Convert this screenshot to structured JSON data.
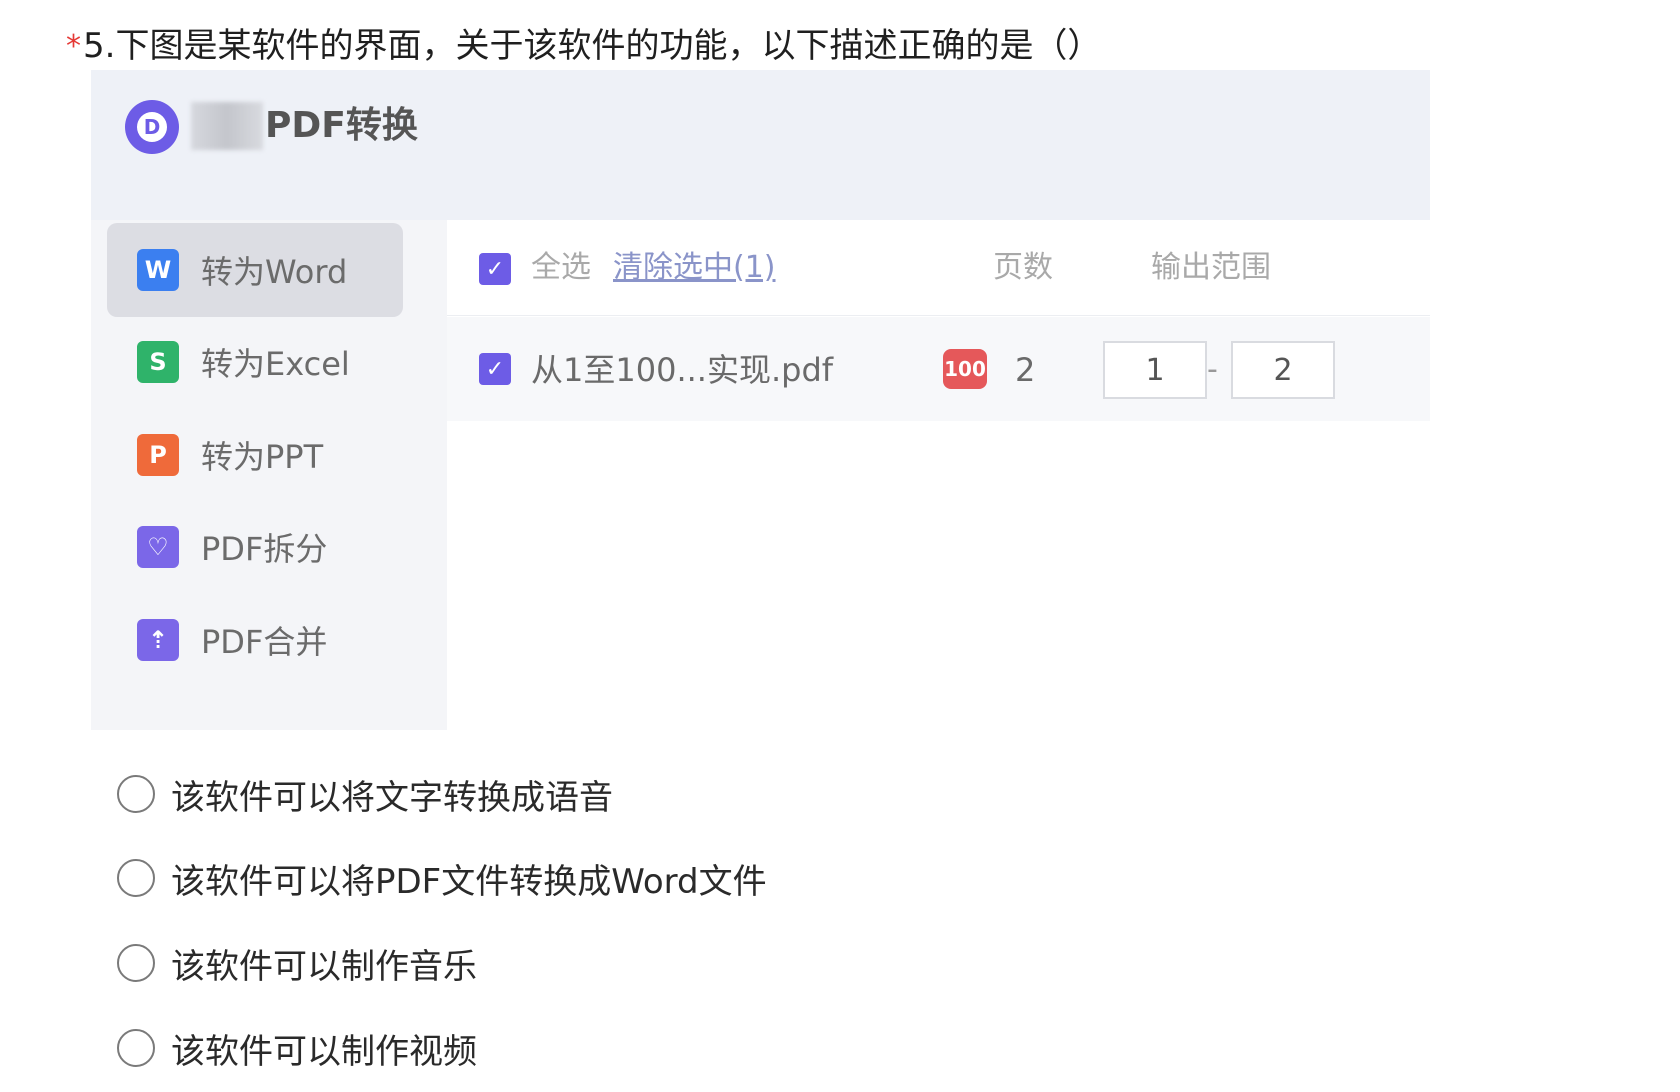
{
  "question": {
    "required_mark": "*",
    "text": "5.下图是某软件的界面，关于该软件的功能，以下描述正确的是（）"
  },
  "app": {
    "title": "PDF转换",
    "sidebar": [
      {
        "label": "转为Word",
        "icon_letter": "W",
        "icon": "word-icon",
        "color": "#3b7ff0"
      },
      {
        "label": "转为Excel",
        "icon_letter": "S",
        "icon": "excel-icon",
        "color": "#2fb36a"
      },
      {
        "label": "转为PPT",
        "icon_letter": "P",
        "icon": "ppt-icon",
        "color": "#ef6a3a"
      },
      {
        "label": "PDF拆分",
        "icon_letter": "♡",
        "icon": "split-icon",
        "color": "#7b67e8"
      },
      {
        "label": "PDF合并",
        "icon_letter": "⇡",
        "icon": "merge-icon",
        "color": "#7b67e8"
      }
    ],
    "table": {
      "select_all": "全选",
      "clear_selection": "清除选中(1)",
      "col_pages": "页数",
      "col_range": "输出范围",
      "row": {
        "filename": "从1至100...实现.pdf",
        "badge": "100",
        "pages": "2",
        "range_from": "1",
        "range_sep": "-",
        "range_to": "2"
      }
    },
    "accent_color": "#6d5ce6"
  },
  "options": [
    "该软件可以将文字转换成语音",
    "该软件可以将PDF文件转换成Word文件",
    "该软件可以制作音乐",
    "该软件可以制作视频"
  ]
}
